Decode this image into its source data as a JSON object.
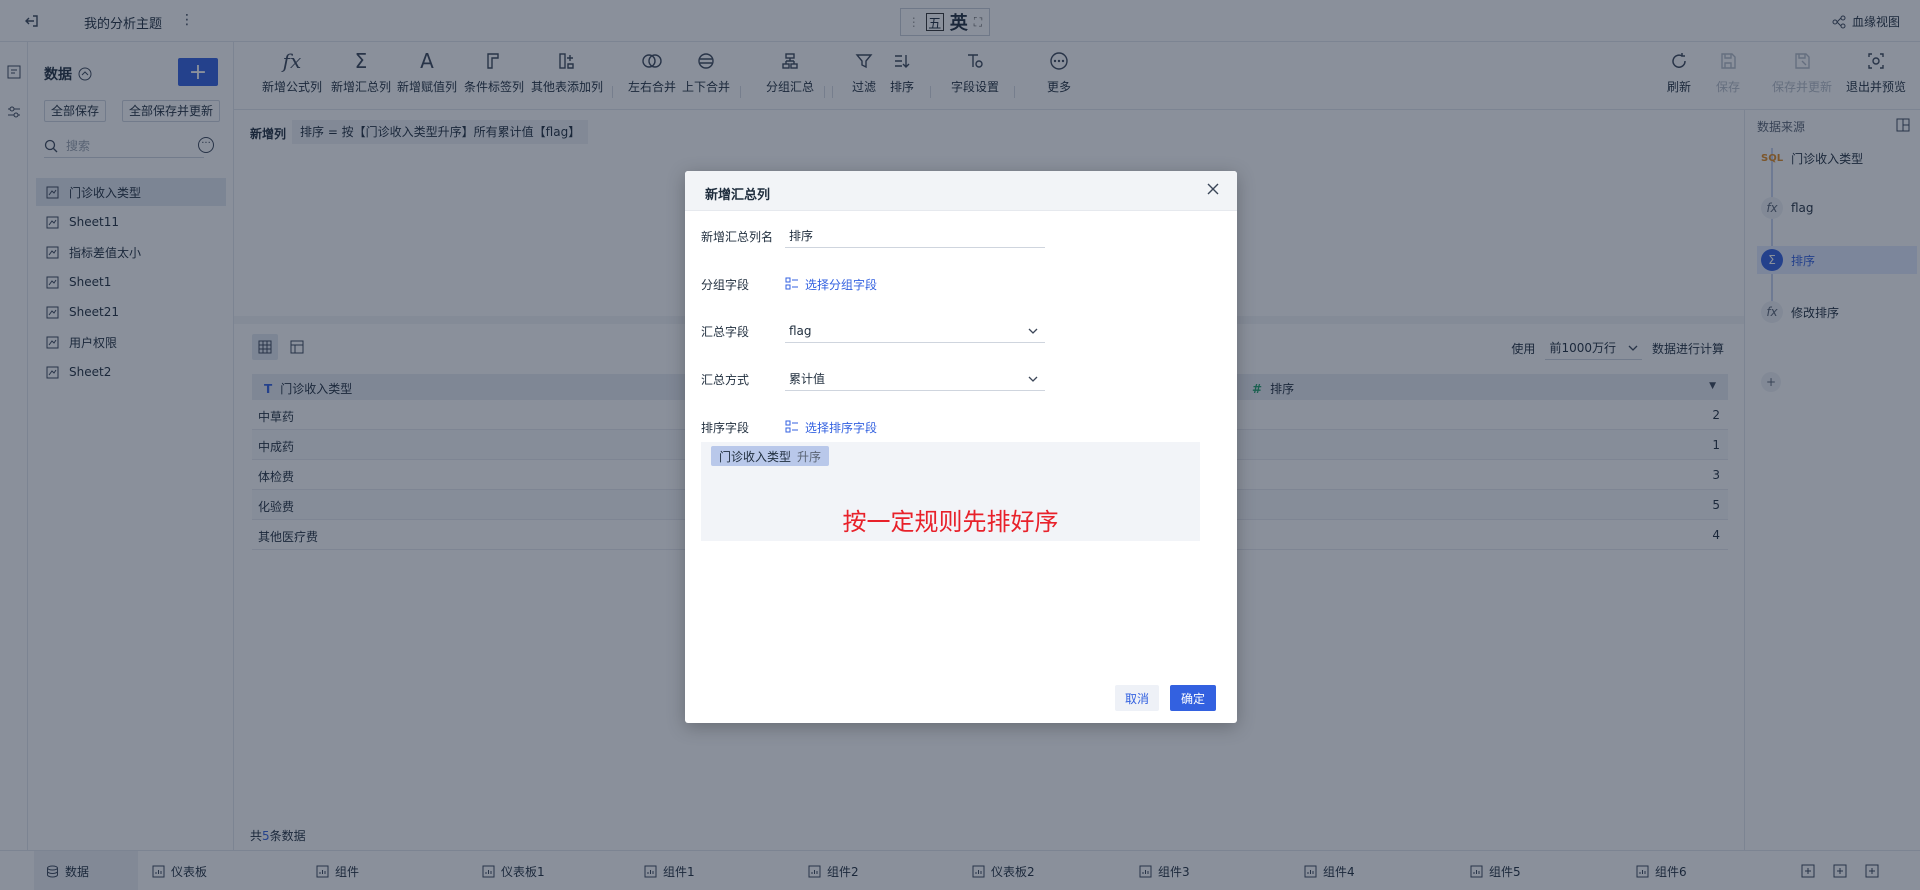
{
  "topbar": {
    "title": "我的分析主题",
    "lineage": "血缘视图"
  },
  "ime": {
    "label": "英"
  },
  "side": {
    "title": "数据",
    "add": "+",
    "save_all": "全部保存",
    "save_all_update": "全部保存并更新",
    "search_placeholder": "搜索",
    "items": [
      "门诊收入类型",
      "Sheet11",
      "指标差值太小",
      "Sheet1",
      "Sheet21",
      "用户权限",
      "Sheet2"
    ]
  },
  "toolbar": {
    "tools": [
      {
        "label": "新增公式列",
        "icon": "fx-icon"
      },
      {
        "label": "新增汇总列",
        "icon": "sigma-icon"
      },
      {
        "label": "新增赋值列",
        "icon": "assign-icon"
      },
      {
        "label": "条件标签列",
        "icon": "tag-icon"
      },
      {
        "label": "其他表添加列",
        "icon": "add-column-icon"
      },
      {
        "label": "左右合并",
        "icon": "merge-horizontal-icon"
      },
      {
        "label": "上下合并",
        "icon": "merge-vertical-icon"
      },
      {
        "label": "分组汇总",
        "icon": "group-icon"
      },
      {
        "label": "过滤",
        "icon": "filter-icon"
      },
      {
        "label": "排序",
        "icon": "sort-icon"
      },
      {
        "label": "字段设置",
        "icon": "field-settings-icon"
      },
      {
        "label": "更多",
        "icon": "more-icon"
      }
    ],
    "right": [
      {
        "label": "刷新",
        "icon": "refresh-icon"
      },
      {
        "label": "保存",
        "icon": "save-icon"
      },
      {
        "label": "保存并更新",
        "icon": "save-update-icon"
      },
      {
        "label": "退出并预览",
        "icon": "exit-preview-icon"
      }
    ]
  },
  "formula": {
    "label": "新增列",
    "expression": "排序 = 按【门诊收入类型升序】所有累计值【flag】"
  },
  "table": {
    "use_label": "使用",
    "rows_option": "前1000万行",
    "calc_label": "数据进行计算",
    "columns": [
      "门诊收入类型",
      "排序"
    ],
    "rows": [
      [
        "中草药",
        "2"
      ],
      [
        "中成药",
        "1"
      ],
      [
        "体检费",
        "3"
      ],
      [
        "化验费",
        "5"
      ],
      [
        "其他医疗费",
        "4"
      ]
    ],
    "total_prefix": "共",
    "total_count": "5",
    "total_suffix": "条数据"
  },
  "right_panel": {
    "title": "数据来源",
    "steps": [
      "门诊收入类型",
      "flag",
      "排序",
      "修改排序"
    ]
  },
  "tabs": [
    "数据",
    "仪表板",
    "组件",
    "仪表板1",
    "组件1",
    "组件2",
    "仪表板2",
    "组件3",
    "组件4",
    "组件5",
    "组件6"
  ],
  "dialog": {
    "title": "新增汇总列",
    "name_label": "新增汇总列名",
    "name_value": "排序",
    "group_label": "分组字段",
    "group_link": "选择分组字段",
    "agg_field_label": "汇总字段",
    "agg_field_value": "flag",
    "agg_method_label": "汇总方式",
    "agg_method_value": "累计值",
    "sort_label": "排序字段",
    "sort_link": "选择排序字段",
    "sort_chip_field": "门诊收入类型",
    "sort_chip_order": "升序",
    "note": "按一定规则先排好序",
    "cancel": "取消",
    "ok": "确定"
  },
  "colors": {
    "accent": "#3361e0",
    "note": "#e8212a"
  }
}
